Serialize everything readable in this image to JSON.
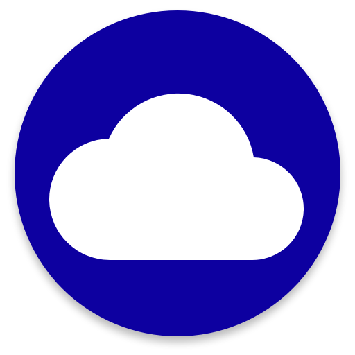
{
  "icon": {
    "name": "cloud-app-icon",
    "shape": "circle",
    "glyph": "cloud-icon",
    "colors": {
      "circle": "#1000A0",
      "cloud": "#FFFFFF",
      "background": "#FFFFFF",
      "shadow": "#000000"
    }
  }
}
